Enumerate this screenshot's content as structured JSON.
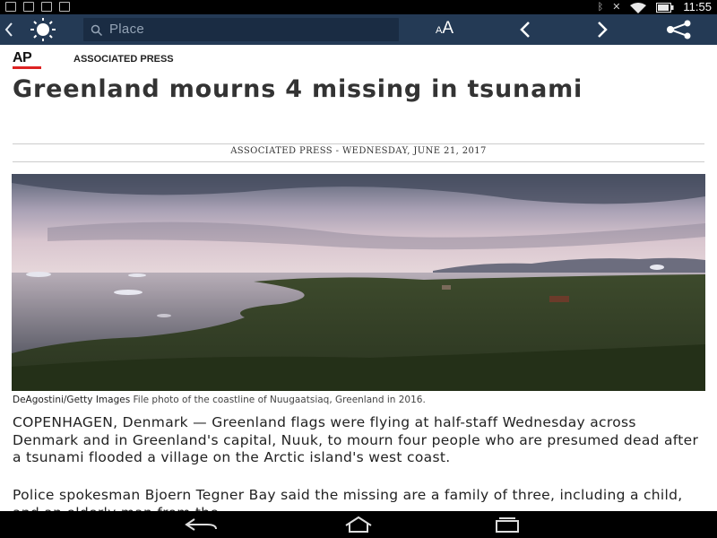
{
  "status_bar": {
    "time": "11:55",
    "icons": [
      "download-icon",
      "image-icon",
      "bars-icon",
      "video-icon",
      "bluetooth-icon",
      "mute-icon",
      "wifi-icon",
      "battery-icon"
    ]
  },
  "toolbar": {
    "search_placeholder": "Place",
    "text_size_small": "A",
    "text_size_large": "A",
    "icons": [
      "back-chevron-icon",
      "sun-icon",
      "search-icon",
      "prev-arrow-icon",
      "next-arrow-icon",
      "share-icon"
    ]
  },
  "source": {
    "logo": "AP",
    "name": "ASSOCIATED PRESS",
    "accent_color": "#dd2222"
  },
  "article": {
    "headline": "Greenland mourns 4 missing in tsunami",
    "byline": "ASSOCIATED PRESS - WEDNESDAY, JUNE 21, 2017",
    "photo_credit": "DeAgostini/Getty Images",
    "photo_caption": "File photo of the coastline of Nuugaatsiaq, Greenland in 2016.",
    "paragraphs": [
      "COPENHAGEN, Denmark — Greenland flags were flying at half-staff Wednesday across Denmark and in Greenland's capital, Nuuk, to mourn four people who are presumed dead after a tsunami flooded a village on the Arctic island's west coast.",
      "Police spokesman Bjoern Tegner Bay said the missing are a family of three, including a child, and an elderly man from the"
    ]
  },
  "colors": {
    "toolbar_bg": "#243a55",
    "search_bg": "#1a2c43",
    "headline_text": "#333333"
  }
}
